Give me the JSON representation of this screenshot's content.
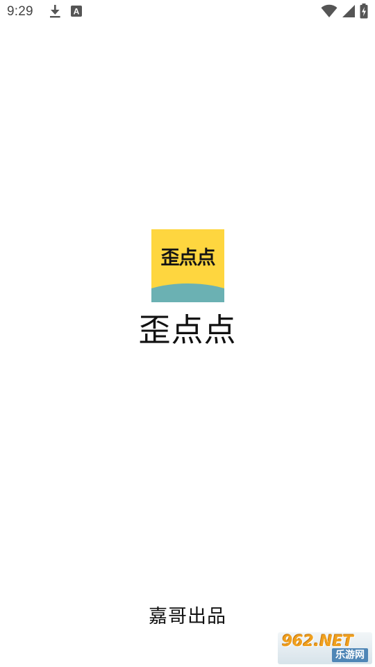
{
  "status_bar": {
    "time": "9:29",
    "left_icons": [
      "download-icon",
      "accessibility-a-icon"
    ],
    "right_icons": [
      "wifi-icon",
      "cell-signal-icon",
      "battery-charging-icon"
    ]
  },
  "splash": {
    "logo_text": "歪点点",
    "app_name": "歪点点",
    "publisher": "嘉哥出品"
  },
  "watermark": {
    "main": "962.NET",
    "sub": "乐游网"
  },
  "colors": {
    "logo_yellow": "#fed63f",
    "logo_teal": "#6bb1b3",
    "text": "#111111",
    "watermark_orange": "#f0a01e",
    "watermark_blue": "#4f86b6"
  }
}
